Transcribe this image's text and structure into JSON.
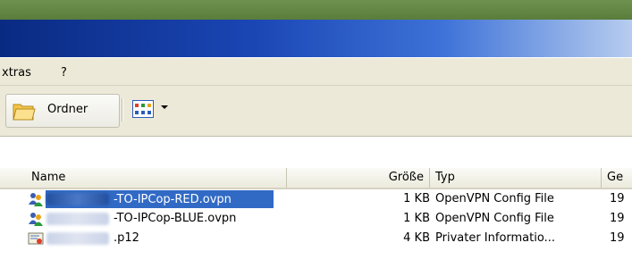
{
  "menu": {
    "items": [
      "xtras",
      "?"
    ]
  },
  "toolbar": {
    "folders_label": "Ordner"
  },
  "columns": {
    "name": "Name",
    "size": "Größe",
    "type": "Typ",
    "date": "Ge"
  },
  "files": [
    {
      "name": "-TO-IPCop-RED.ovpn",
      "size": "1 KB",
      "type": "OpenVPN Config File",
      "date": "19",
      "selected": true
    },
    {
      "name": "-TO-IPCop-BLUE.ovpn",
      "size": "1 KB",
      "type": "OpenVPN Config File",
      "date": "19",
      "selected": false
    },
    {
      "name": ".p12",
      "size": "4 KB",
      "type": "Privater Informatio...",
      "date": "19",
      "selected": false
    }
  ],
  "colors": {
    "titlebar": "#1a46b4",
    "selection": "#316ac5",
    "chrome": "#ece9d8"
  }
}
